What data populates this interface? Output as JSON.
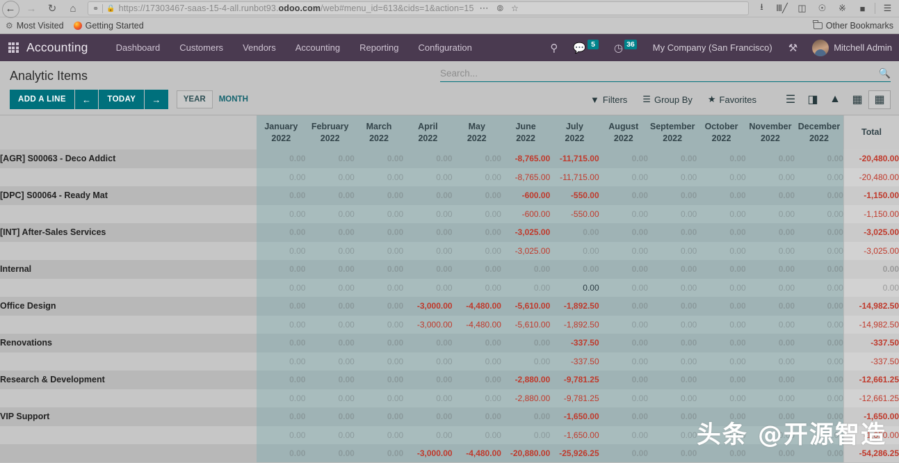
{
  "browser": {
    "nav_icons": [
      "back-arrow",
      "forward-arrow",
      "reload",
      "home"
    ],
    "url": "https://17303467-saas-15-4-all.runbot93.odoo.com/web#menu_id=613&cids=1&action=15",
    "url_prefix": "https://17303467-saas-15-4-all.runbot93.",
    "url_domain": "odoo.com",
    "url_suffix": "/web#menu_id=613&cids=1&action=15",
    "toolbar_icons": [
      "downloads-icon",
      "library-icon",
      "reader-view-icon",
      "account-icon",
      "extension-icon",
      "pocket-icon",
      "hamburger-menu-icon"
    ],
    "bookmarks": [
      {
        "label": "Most Visited",
        "icon": "gear-icon"
      },
      {
        "label": "Getting Started",
        "icon": "firefox-icon"
      }
    ],
    "other_bookmarks": "Other Bookmarks"
  },
  "navbar": {
    "apps_icon": "apps-grid-icon",
    "brand": "Accounting",
    "menu": [
      "Dashboard",
      "Customers",
      "Vendors",
      "Accounting",
      "Reporting",
      "Configuration"
    ],
    "icons": {
      "debug": "bug-icon",
      "messages": "messages-icon",
      "messages_count": "5",
      "activities": "clock-icon",
      "activities_count": "36",
      "settings": "tools-icon"
    },
    "company": "My Company (San Francisco)",
    "user": "Mitchell Admin",
    "avatar": "user-avatar"
  },
  "control_panel": {
    "title": "Analytic Items",
    "add_line": "ADD A LINE",
    "prev": "←",
    "today": "TODAY",
    "next": "→",
    "scale_year": "YEAR",
    "scale_month": "MONTH",
    "search_placeholder": "Search...",
    "search_value": "",
    "filters": "Filters",
    "group_by": "Group By",
    "favorites": "Favorites",
    "views": [
      "list-view-icon",
      "kanban-view-icon",
      "graph-view-icon",
      "pivot-view-icon",
      "grid-view-icon"
    ],
    "active_view": "grid-view-icon"
  },
  "chart_data": {
    "type": "table",
    "title": "Analytic Items",
    "columns": [
      {
        "month": "January",
        "year": "2022"
      },
      {
        "month": "February",
        "year": "2022"
      },
      {
        "month": "March",
        "year": "2022"
      },
      {
        "month": "April",
        "year": "2022"
      },
      {
        "month": "May",
        "year": "2022"
      },
      {
        "month": "June",
        "year": "2022"
      },
      {
        "month": "July",
        "year": "2022"
      },
      {
        "month": "August",
        "year": "2022"
      },
      {
        "month": "September",
        "year": "2022"
      },
      {
        "month": "October",
        "year": "2022"
      },
      {
        "month": "November",
        "year": "2022"
      },
      {
        "month": "December",
        "year": "2022"
      }
    ],
    "total_header": "Total",
    "rows": [
      {
        "label": "[AGR] S00063 - Deco Addict",
        "type": "group",
        "values": [
          "0.00",
          "0.00",
          "0.00",
          "0.00",
          "0.00",
          "-8,765.00",
          "-11,715.00",
          "0.00",
          "0.00",
          "0.00",
          "0.00",
          "0.00"
        ],
        "total": "-20,480.00"
      },
      {
        "label": "",
        "type": "sub",
        "values": [
          "0.00",
          "0.00",
          "0.00",
          "0.00",
          "0.00",
          "-8,765.00",
          "-11,715.00",
          "0.00",
          "0.00",
          "0.00",
          "0.00",
          "0.00"
        ],
        "total": "-20,480.00"
      },
      {
        "label": "[DPC] S00064 - Ready Mat",
        "type": "group",
        "values": [
          "0.00",
          "0.00",
          "0.00",
          "0.00",
          "0.00",
          "-600.00",
          "-550.00",
          "0.00",
          "0.00",
          "0.00",
          "0.00",
          "0.00"
        ],
        "total": "-1,150.00"
      },
      {
        "label": "",
        "type": "sub",
        "values": [
          "0.00",
          "0.00",
          "0.00",
          "0.00",
          "0.00",
          "-600.00",
          "-550.00",
          "0.00",
          "0.00",
          "0.00",
          "0.00",
          "0.00"
        ],
        "total": "-1,150.00"
      },
      {
        "label": "[INT] After-Sales Services",
        "type": "group",
        "values": [
          "0.00",
          "0.00",
          "0.00",
          "0.00",
          "0.00",
          "-3,025.00",
          "0.00",
          "0.00",
          "0.00",
          "0.00",
          "0.00",
          "0.00"
        ],
        "total": "-3,025.00"
      },
      {
        "label": "",
        "type": "sub",
        "values": [
          "0.00",
          "0.00",
          "0.00",
          "0.00",
          "0.00",
          "-3,025.00",
          "0.00",
          "0.00",
          "0.00",
          "0.00",
          "0.00",
          "0.00"
        ],
        "total": "-3,025.00"
      },
      {
        "label": "Internal",
        "type": "group",
        "values": [
          "0.00",
          "0.00",
          "0.00",
          "0.00",
          "0.00",
          "0.00",
          "0.00",
          "0.00",
          "0.00",
          "0.00",
          "0.00",
          "0.00"
        ],
        "total": "0.00"
      },
      {
        "label": "",
        "type": "sub",
        "values": [
          "0.00",
          "0.00",
          "0.00",
          "0.00",
          "0.00",
          "0.00",
          "0.00",
          "0.00",
          "0.00",
          "0.00",
          "0.00",
          "0.00"
        ],
        "total": "0.00",
        "real_zero_index": 6
      },
      {
        "label": "Office Design",
        "type": "group",
        "values": [
          "0.00",
          "0.00",
          "0.00",
          "-3,000.00",
          "-4,480.00",
          "-5,610.00",
          "-1,892.50",
          "0.00",
          "0.00",
          "0.00",
          "0.00",
          "0.00"
        ],
        "total": "-14,982.50"
      },
      {
        "label": "",
        "type": "sub",
        "values": [
          "0.00",
          "0.00",
          "0.00",
          "-3,000.00",
          "-4,480.00",
          "-5,610.00",
          "-1,892.50",
          "0.00",
          "0.00",
          "0.00",
          "0.00",
          "0.00"
        ],
        "total": "-14,982.50"
      },
      {
        "label": "Renovations",
        "type": "group",
        "values": [
          "0.00",
          "0.00",
          "0.00",
          "0.00",
          "0.00",
          "0.00",
          "-337.50",
          "0.00",
          "0.00",
          "0.00",
          "0.00",
          "0.00"
        ],
        "total": "-337.50"
      },
      {
        "label": "",
        "type": "sub",
        "values": [
          "0.00",
          "0.00",
          "0.00",
          "0.00",
          "0.00",
          "0.00",
          "-337.50",
          "0.00",
          "0.00",
          "0.00",
          "0.00",
          "0.00"
        ],
        "total": "-337.50"
      },
      {
        "label": "Research & Development",
        "type": "group",
        "values": [
          "0.00",
          "0.00",
          "0.00",
          "0.00",
          "0.00",
          "-2,880.00",
          "-9,781.25",
          "0.00",
          "0.00",
          "0.00",
          "0.00",
          "0.00"
        ],
        "total": "-12,661.25"
      },
      {
        "label": "",
        "type": "sub",
        "values": [
          "0.00",
          "0.00",
          "0.00",
          "0.00",
          "0.00",
          "-2,880.00",
          "-9,781.25",
          "0.00",
          "0.00",
          "0.00",
          "0.00",
          "0.00"
        ],
        "total": "-12,661.25"
      },
      {
        "label": "VIP Support",
        "type": "group",
        "values": [
          "0.00",
          "0.00",
          "0.00",
          "0.00",
          "0.00",
          "0.00",
          "-1,650.00",
          "0.00",
          "0.00",
          "0.00",
          "0.00",
          "0.00"
        ],
        "total": "-1,650.00"
      },
      {
        "label": "",
        "type": "sub",
        "values": [
          "0.00",
          "0.00",
          "0.00",
          "0.00",
          "0.00",
          "0.00",
          "-1,650.00",
          "0.00",
          "0.00",
          "0.00",
          "0.00",
          "0.00"
        ],
        "total": "-1,650.00"
      },
      {
        "label": "",
        "type": "bottom-total",
        "values": [
          "0.00",
          "0.00",
          "0.00",
          "-3,000.00",
          "-4,480.00",
          "-20,880.00",
          "-25,926.25",
          "0.00",
          "0.00",
          "0.00",
          "0.00",
          "0.00"
        ],
        "total": "-54,286.25"
      }
    ]
  },
  "watermark": "头条 @开源智造"
}
